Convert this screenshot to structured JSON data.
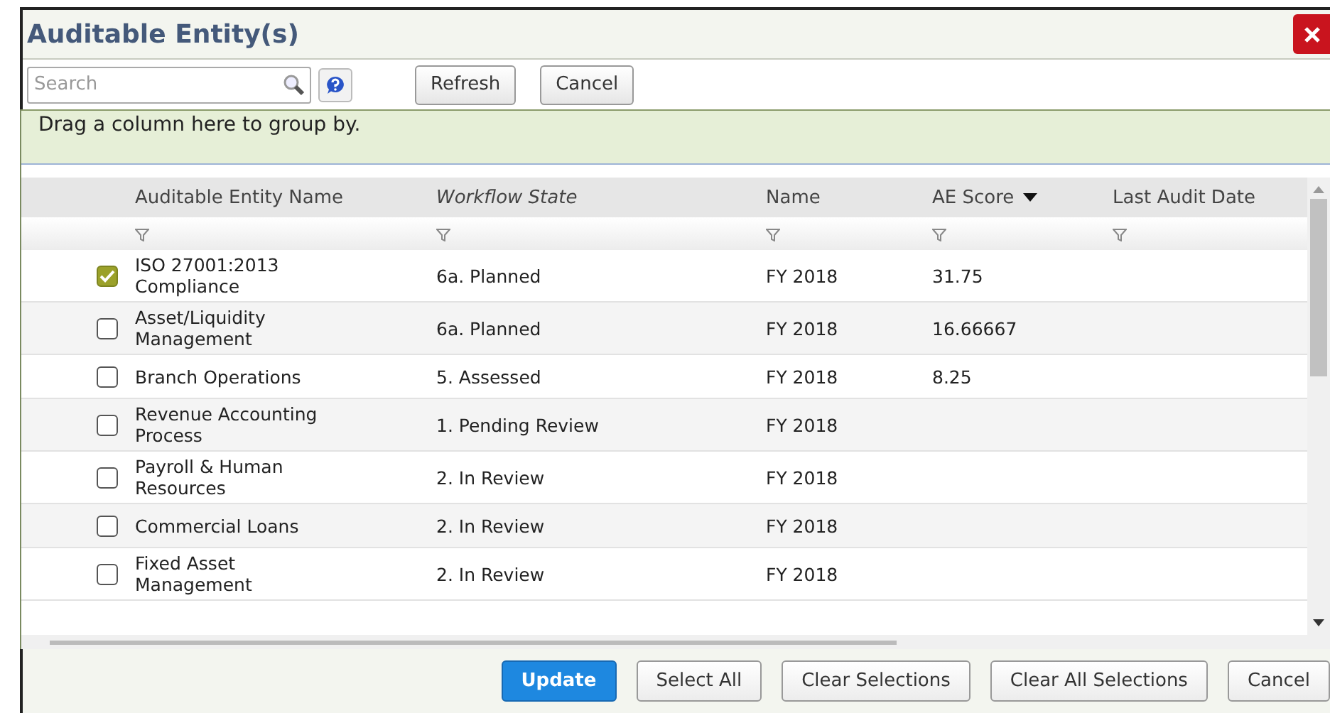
{
  "window": {
    "title": "Auditable Entity(s)"
  },
  "toolbar": {
    "search": {
      "placeholder": "Search"
    },
    "buttons": [
      "Refresh",
      "Cancel"
    ]
  },
  "group_hint": "Drag a column here to group by.",
  "table": {
    "columns": [
      {
        "label": "Auditable Entity Name",
        "italic": false,
        "sorted": false
      },
      {
        "label": "Workflow State",
        "italic": true,
        "sorted": false
      },
      {
        "label": "Name",
        "italic": false,
        "sorted": false
      },
      {
        "label": "AE Score",
        "italic": false,
        "sorted": true
      },
      {
        "label": "Last Audit Date",
        "italic": false,
        "sorted": false
      }
    ],
    "rows": [
      {
        "checked": true,
        "cells": [
          "ISO 27001:2013 Compliance",
          "6a. Planned",
          "FY 2018",
          "31.75"
        ]
      },
      {
        "checked": false,
        "cells": [
          "Asset/Liquidity Management",
          "6a. Planned",
          "FY 2018",
          "16.66667"
        ]
      },
      {
        "checked": false,
        "cells": [
          "Branch Operations",
          "5. Assessed",
          "FY 2018",
          "8.25"
        ]
      },
      {
        "checked": false,
        "cells": [
          "Revenue Accounting Process",
          "1. Pending Review",
          "FY 2018"
        ]
      },
      {
        "checked": false,
        "cells": [
          "Payroll & Human Resources",
          "2. In Review",
          "FY 2018"
        ]
      },
      {
        "checked": false,
        "cells": [
          "Commercial Loans",
          "2. In Review",
          "FY 2018"
        ]
      },
      {
        "checked": false,
        "cells": [
          "Fixed Asset Management",
          "2. In Review",
          "FY 2018"
        ]
      }
    ]
  },
  "footer_buttons": [
    {
      "label": "Update",
      "primary": true
    },
    {
      "label": "Select All",
      "primary": false
    },
    {
      "label": "Clear Selections",
      "primary": false
    },
    {
      "label": "Clear All Selections",
      "primary": false
    },
    {
      "label": "Cancel",
      "primary": false
    }
  ]
}
